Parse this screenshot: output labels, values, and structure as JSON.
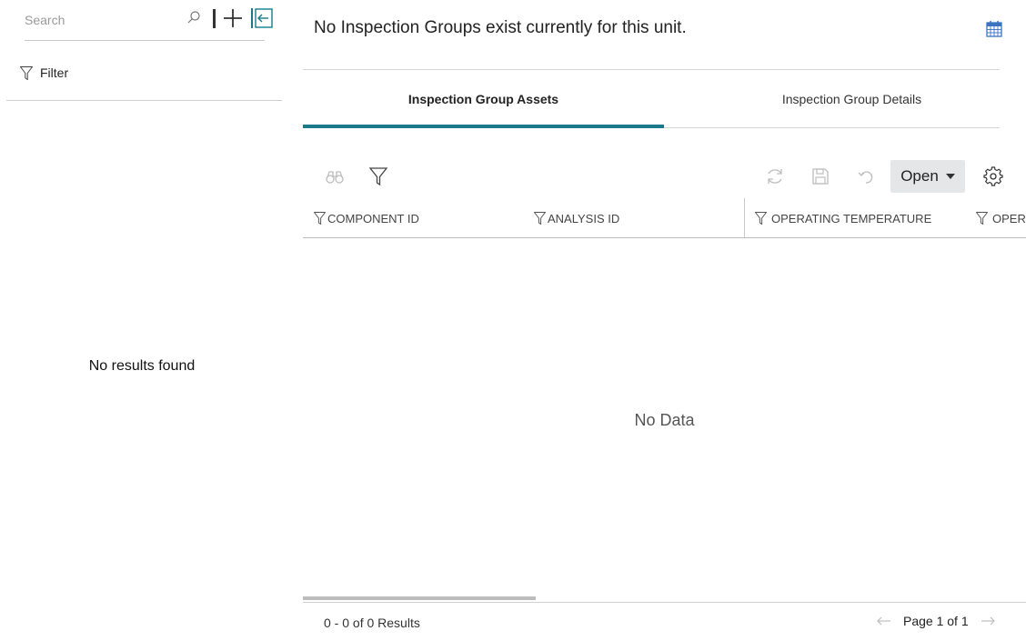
{
  "sidebar": {
    "search_placeholder": "Search",
    "filter_label": "Filter",
    "empty_message": "No results found",
    "icons": [
      "search-icon",
      "add-icon",
      "collapse-panel-icon",
      "filter-icon"
    ]
  },
  "main": {
    "notice": "No Inspection Groups exist currently for this unit.",
    "calendar_icon": "calendar-icon",
    "tabs": [
      {
        "label": "Inspection Group Assets",
        "active": true
      },
      {
        "label": "Inspection Group Details",
        "active": false
      }
    ],
    "toolbar": {
      "left_icons": [
        "binoculars-icon",
        "filter-icon"
      ],
      "right_icons": [
        "refresh-icon",
        "save-icon",
        "undo-icon",
        "gear-icon"
      ],
      "open_label": "Open"
    },
    "grid": {
      "columns": [
        "COMPONENT ID",
        "ANALYSIS ID",
        "OPERATING TEMPERATURE",
        "OPER"
      ],
      "empty_message": "No Data"
    },
    "footer": {
      "results": "0 - 0 of 0 Results",
      "page_label": "Page 1 of 1"
    }
  },
  "colors": {
    "accent": "#1a7a8c",
    "calendar_blue": "#3b73c4",
    "open_button_bg": "#e4e6e8",
    "disabled_icon": "#bdbdbd"
  }
}
